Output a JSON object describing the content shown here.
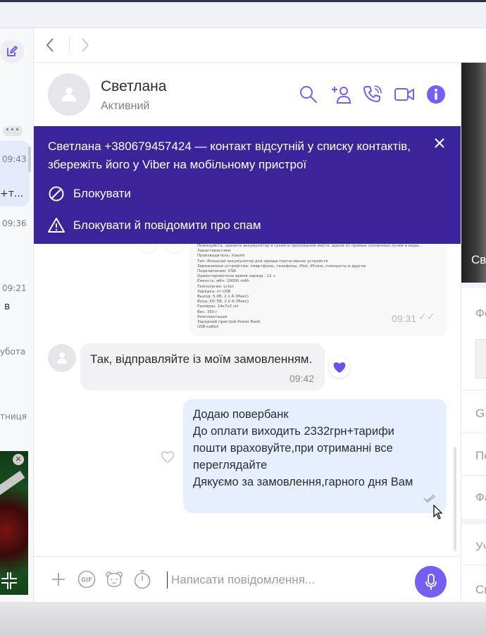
{
  "window": {
    "title": ""
  },
  "sidebar": {
    "items": [
      {
        "time": "09:43",
        "preview": "+т..."
      },
      {
        "time": "09:36",
        "preview": ""
      },
      {
        "time": "09:21",
        "preview": "в"
      },
      {
        "time": "убота",
        "preview": ""
      },
      {
        "time": "тниця",
        "preview": ""
      }
    ],
    "more_label": "•••"
  },
  "header": {
    "contact_name": "Светлана",
    "contact_status": "Активний"
  },
  "banner": {
    "text": "Светлана +380679457424 — контакт відсутній у списку контактів, збережіть його у Viber на мобільному пристрої",
    "block_label": "Блокувати",
    "block_report_label": "Блокувати й повідомити про спам"
  },
  "messages": {
    "image_message": {
      "time": "09:31",
      "spec_lines": [
        "Пожалуйста, храните аккумулятор в сухом и прохладном месте, вдали от прямых солнечных лучей и воды.",
        "Характеристики",
        "Производитель: Xiaomi",
        "Тип: Внешний аккумулятор для заряда портативных устройств",
        "Заряжаемые устройства: смартфоны, телефоны, iPod, iPhone, планшеты и другое",
        "Подключение: USB",
        "Ориентировочное время заряда : 12 ч",
        "Емкость, мАч: 20000 mAh",
        "Технология: Li-Ion",
        "Зарядка: от USB",
        "Выход: 5.0В, 2.1 А (Макс)",
        "Вход: DC 5В, 2.0 А (Макс)",
        "Размеры: 14x7x2 см",
        "Вес: 350 г",
        "Комплектация",
        "Зарядний пристрій Power Bank",
        "USB-кабел"
      ]
    },
    "incoming": {
      "text": "Так, відправляйте із моїм замовленням.",
      "time": "09:42"
    },
    "outgoing": {
      "lines": [
        "Додаю повербанк",
        "До оплати виходить 2332грн+тарифи",
        "пошти враховуйте,при отриманні все",
        "переглядайте",
        "Дякуємо за замовлення,гарного дня Вам"
      ]
    }
  },
  "composer": {
    "placeholder": "Написати повідомлення...",
    "gif_label": "GIF"
  },
  "right_panel": {
    "photo_label": "Св",
    "items": [
      "Фо",
      "GI",
      "По",
      "Фа",
      "Уч",
      "Сп"
    ]
  },
  "colors": {
    "accent": "#7360f2",
    "banner_bg": "#3b2399",
    "outgoing_bubble": "#e7efff",
    "incoming_bubble": "#f2f2f4"
  }
}
